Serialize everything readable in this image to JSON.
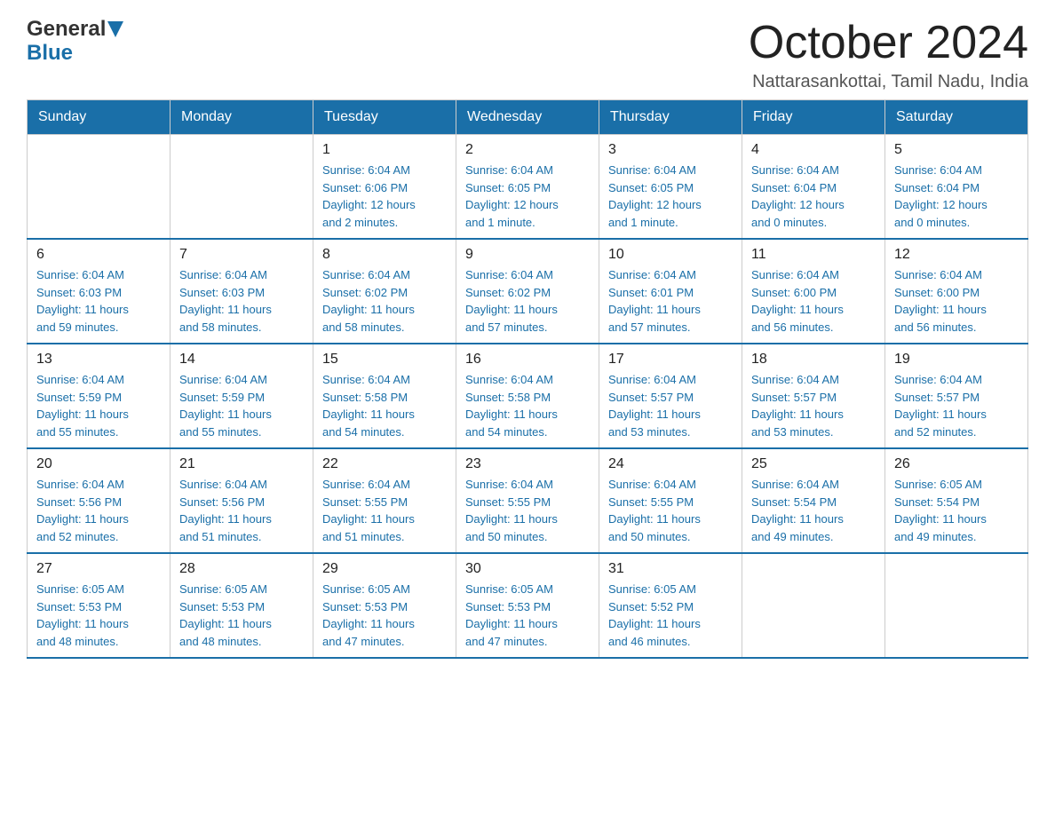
{
  "header": {
    "logo_general": "General",
    "logo_blue": "Blue",
    "month_title": "October 2024",
    "location": "Nattarasankottai, Tamil Nadu, India"
  },
  "days_of_week": [
    "Sunday",
    "Monday",
    "Tuesday",
    "Wednesday",
    "Thursday",
    "Friday",
    "Saturday"
  ],
  "weeks": [
    [
      {
        "day": "",
        "info": ""
      },
      {
        "day": "",
        "info": ""
      },
      {
        "day": "1",
        "info": "Sunrise: 6:04 AM\nSunset: 6:06 PM\nDaylight: 12 hours\nand 2 minutes."
      },
      {
        "day": "2",
        "info": "Sunrise: 6:04 AM\nSunset: 6:05 PM\nDaylight: 12 hours\nand 1 minute."
      },
      {
        "day": "3",
        "info": "Sunrise: 6:04 AM\nSunset: 6:05 PM\nDaylight: 12 hours\nand 1 minute."
      },
      {
        "day": "4",
        "info": "Sunrise: 6:04 AM\nSunset: 6:04 PM\nDaylight: 12 hours\nand 0 minutes."
      },
      {
        "day": "5",
        "info": "Sunrise: 6:04 AM\nSunset: 6:04 PM\nDaylight: 12 hours\nand 0 minutes."
      }
    ],
    [
      {
        "day": "6",
        "info": "Sunrise: 6:04 AM\nSunset: 6:03 PM\nDaylight: 11 hours\nand 59 minutes."
      },
      {
        "day": "7",
        "info": "Sunrise: 6:04 AM\nSunset: 6:03 PM\nDaylight: 11 hours\nand 58 minutes."
      },
      {
        "day": "8",
        "info": "Sunrise: 6:04 AM\nSunset: 6:02 PM\nDaylight: 11 hours\nand 58 minutes."
      },
      {
        "day": "9",
        "info": "Sunrise: 6:04 AM\nSunset: 6:02 PM\nDaylight: 11 hours\nand 57 minutes."
      },
      {
        "day": "10",
        "info": "Sunrise: 6:04 AM\nSunset: 6:01 PM\nDaylight: 11 hours\nand 57 minutes."
      },
      {
        "day": "11",
        "info": "Sunrise: 6:04 AM\nSunset: 6:00 PM\nDaylight: 11 hours\nand 56 minutes."
      },
      {
        "day": "12",
        "info": "Sunrise: 6:04 AM\nSunset: 6:00 PM\nDaylight: 11 hours\nand 56 minutes."
      }
    ],
    [
      {
        "day": "13",
        "info": "Sunrise: 6:04 AM\nSunset: 5:59 PM\nDaylight: 11 hours\nand 55 minutes."
      },
      {
        "day": "14",
        "info": "Sunrise: 6:04 AM\nSunset: 5:59 PM\nDaylight: 11 hours\nand 55 minutes."
      },
      {
        "day": "15",
        "info": "Sunrise: 6:04 AM\nSunset: 5:58 PM\nDaylight: 11 hours\nand 54 minutes."
      },
      {
        "day": "16",
        "info": "Sunrise: 6:04 AM\nSunset: 5:58 PM\nDaylight: 11 hours\nand 54 minutes."
      },
      {
        "day": "17",
        "info": "Sunrise: 6:04 AM\nSunset: 5:57 PM\nDaylight: 11 hours\nand 53 minutes."
      },
      {
        "day": "18",
        "info": "Sunrise: 6:04 AM\nSunset: 5:57 PM\nDaylight: 11 hours\nand 53 minutes."
      },
      {
        "day": "19",
        "info": "Sunrise: 6:04 AM\nSunset: 5:57 PM\nDaylight: 11 hours\nand 52 minutes."
      }
    ],
    [
      {
        "day": "20",
        "info": "Sunrise: 6:04 AM\nSunset: 5:56 PM\nDaylight: 11 hours\nand 52 minutes."
      },
      {
        "day": "21",
        "info": "Sunrise: 6:04 AM\nSunset: 5:56 PM\nDaylight: 11 hours\nand 51 minutes."
      },
      {
        "day": "22",
        "info": "Sunrise: 6:04 AM\nSunset: 5:55 PM\nDaylight: 11 hours\nand 51 minutes."
      },
      {
        "day": "23",
        "info": "Sunrise: 6:04 AM\nSunset: 5:55 PM\nDaylight: 11 hours\nand 50 minutes."
      },
      {
        "day": "24",
        "info": "Sunrise: 6:04 AM\nSunset: 5:55 PM\nDaylight: 11 hours\nand 50 minutes."
      },
      {
        "day": "25",
        "info": "Sunrise: 6:04 AM\nSunset: 5:54 PM\nDaylight: 11 hours\nand 49 minutes."
      },
      {
        "day": "26",
        "info": "Sunrise: 6:05 AM\nSunset: 5:54 PM\nDaylight: 11 hours\nand 49 minutes."
      }
    ],
    [
      {
        "day": "27",
        "info": "Sunrise: 6:05 AM\nSunset: 5:53 PM\nDaylight: 11 hours\nand 48 minutes."
      },
      {
        "day": "28",
        "info": "Sunrise: 6:05 AM\nSunset: 5:53 PM\nDaylight: 11 hours\nand 48 minutes."
      },
      {
        "day": "29",
        "info": "Sunrise: 6:05 AM\nSunset: 5:53 PM\nDaylight: 11 hours\nand 47 minutes."
      },
      {
        "day": "30",
        "info": "Sunrise: 6:05 AM\nSunset: 5:53 PM\nDaylight: 11 hours\nand 47 minutes."
      },
      {
        "day": "31",
        "info": "Sunrise: 6:05 AM\nSunset: 5:52 PM\nDaylight: 11 hours\nand 46 minutes."
      },
      {
        "day": "",
        "info": ""
      },
      {
        "day": "",
        "info": ""
      }
    ]
  ]
}
